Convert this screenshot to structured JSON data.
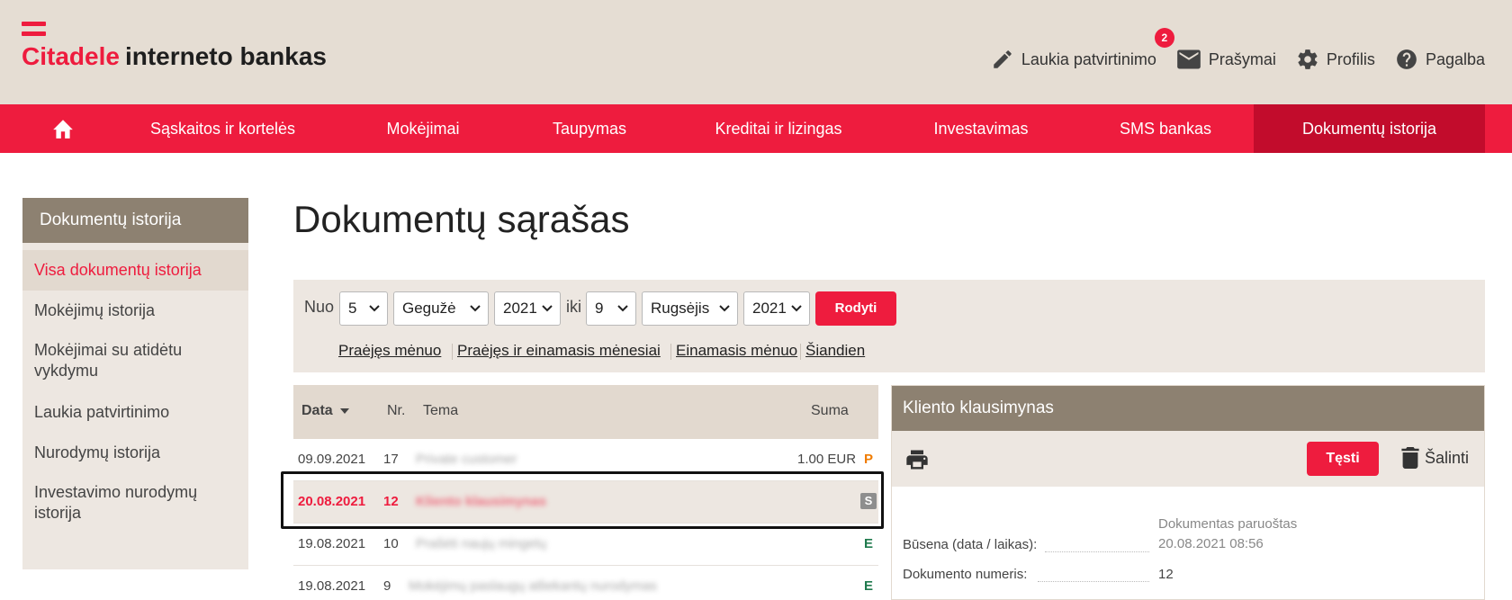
{
  "brand": {
    "name": "Citadele",
    "rest": "interneto bankas",
    "accent": "#ee1c3e"
  },
  "top_links": [
    {
      "icon": "pencil-icon",
      "label": "Laukia patvirtinimo",
      "badge": "2"
    },
    {
      "icon": "mail-icon",
      "label": "Prašymai"
    },
    {
      "icon": "gear-icon",
      "label": "Profilis"
    },
    {
      "icon": "help-icon",
      "label": "Pagalba"
    }
  ],
  "nav": {
    "home_icon": "home-icon",
    "items": [
      "Sąskaitos ir kortelės",
      "Mokėjimai",
      "Taupymas",
      "Kreditai ir lizingas",
      "Investavimas",
      "SMS bankas",
      "Dokumentų istorija"
    ],
    "active": "Dokumentų istorija"
  },
  "sidebar": {
    "title": "Dokumentų istorija",
    "items": [
      "Visa dokumentų istorija",
      "Mokėjimų istorija",
      "Mokėjimai su atidėtu vykdymu",
      "Laukia patvirtinimo",
      "Nurodymų istorija",
      "Investavimo nurodymų istorija"
    ],
    "active": "Visa dokumentų istorija"
  },
  "page": {
    "title": "Dokumentų sąrašas"
  },
  "filter": {
    "from_label": "Nuo",
    "to_label": "iki",
    "from_day": "5",
    "from_month": "Gegužė",
    "from_year": "2021",
    "to_day": "9",
    "to_month": "Rugsėjis",
    "to_year": "2021",
    "show_button": "Rodyti",
    "quick_links": [
      "Praėjęs mėnuo",
      "Praėjęs ir einamasis mėnesiai",
      "Einamasis mėnuo",
      "Šiandien"
    ]
  },
  "table": {
    "headers": {
      "date": "Data",
      "nr": "Nr.",
      "subject": "Tema",
      "amount": "Suma"
    },
    "rows": [
      {
        "date": "09.09.2021",
        "nr": "17",
        "subject": "Private customer",
        "amount": "1.00 EUR",
        "status": "P",
        "status_color": "#f07c00"
      },
      {
        "date": "20.08.2021",
        "nr": "12",
        "subject": "Kliento klausimynas",
        "amount": "",
        "status": "S",
        "status_color": "#8e8e8e",
        "selected": true
      },
      {
        "date": "19.08.2021",
        "nr": "10",
        "subject": "Prašėti naujų mingetų",
        "amount": "",
        "status": "E",
        "status_color": "#1f7a4d"
      },
      {
        "date": "19.08.2021",
        "nr": "9",
        "subject": "Mokėjimų paslaugų atliekantų nurodymas",
        "amount": "",
        "status": "E",
        "status_color": "#1f7a4d"
      }
    ]
  },
  "detail": {
    "title": "Kliento klausimynas",
    "print_icon": "printer-icon",
    "continue_button": "Tęsti",
    "delete_icon": "trash-icon",
    "delete_label": "Šalinti",
    "status_label": "Būsena (data / laikas):",
    "status_value": "Dokumentas paruoštas",
    "status_time": "20.08.2021 08:56",
    "docnum_label": "Dokumento numeris:",
    "docnum_value": "12"
  }
}
